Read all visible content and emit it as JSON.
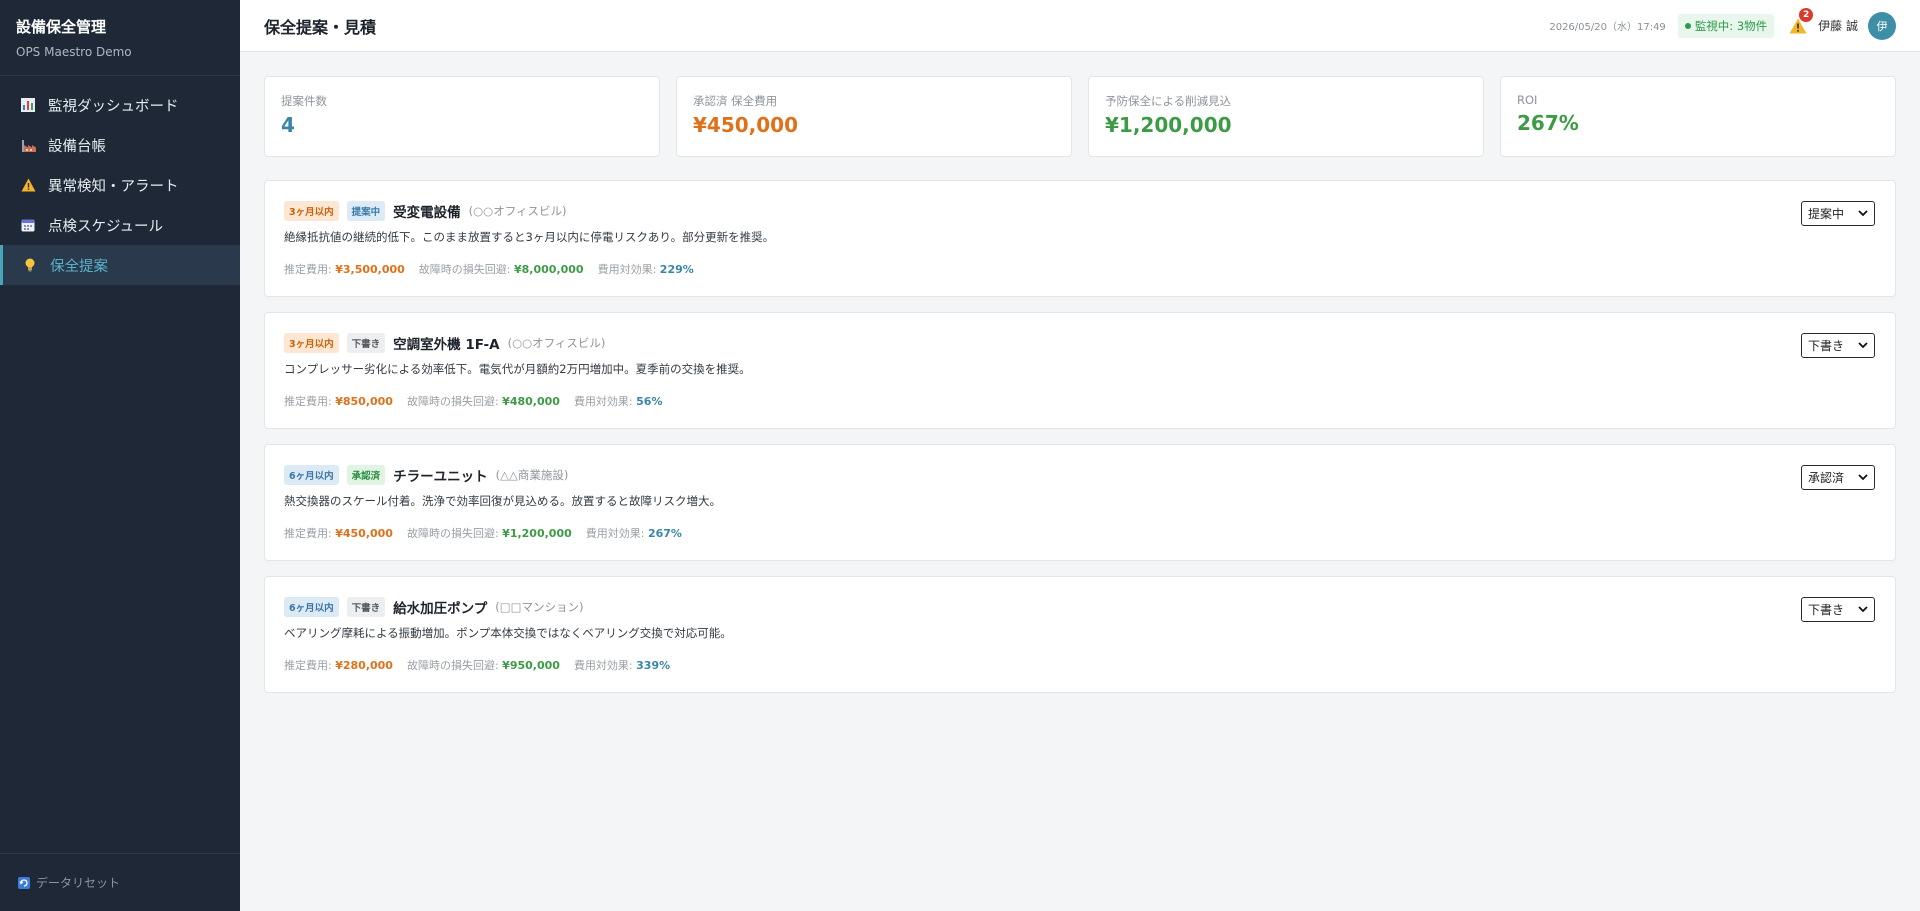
{
  "sidebar": {
    "title": "設備保全管理",
    "subtitle": "OPS Maestro Demo",
    "items": [
      {
        "label": "監視ダッシュボード",
        "icon": "bar-chart-icon"
      },
      {
        "label": "設備台帳",
        "icon": "factory-icon"
      },
      {
        "label": "異常検知・アラート",
        "icon": "warning-icon"
      },
      {
        "label": "点検スケジュール",
        "icon": "calendar-icon"
      },
      {
        "label": "保全提案",
        "icon": "lightbulb-icon"
      }
    ],
    "active_index": 4,
    "footer_label": "データリセット"
  },
  "header": {
    "title": "保全提案・見積",
    "datetime": "2026/05/20（水）17:49",
    "monitor_status": "監視中: 3物件",
    "alert_count": "2",
    "user_name": "伊藤 誠",
    "avatar_initial": "伊"
  },
  "stats": [
    {
      "label": "提案件数",
      "value": "4",
      "color": "#3a86a8"
    },
    {
      "label": "承認済 保全費用",
      "value": "¥450,000",
      "color": "#e0711a"
    },
    {
      "label": "予防保全による削減見込",
      "value": "¥1,200,000",
      "color": "#3d9b46"
    },
    {
      "label": "ROI",
      "value": "267%",
      "color": "#3d9b46"
    }
  ],
  "meta_labels": {
    "cost": "推定費用: ",
    "avoided": "故障時の損失回避: ",
    "effect": "費用対効果: "
  },
  "proposals": [
    {
      "period": "3ヶ月以内",
      "status": "提案中",
      "name": "受変電設備",
      "site": "(○○オフィスビル)",
      "desc": "絶縁抵抗値の継続的低下。このまま放置すると3ヶ月以内に停電リスクあり。部分更新を推奨。",
      "cost": "¥3,500,000",
      "avoided": "¥8,000,000",
      "effect": "229%",
      "select_value": "提案中"
    },
    {
      "period": "3ヶ月以内",
      "status": "下書き",
      "name": "空調室外機 1F-A",
      "site": "(○○オフィスビル)",
      "desc": "コンプレッサー劣化による効率低下。電気代が月額約2万円増加中。夏季前の交換を推奨。",
      "cost": "¥850,000",
      "avoided": "¥480,000",
      "effect": "56%",
      "select_value": "下書き"
    },
    {
      "period": "6ヶ月以内",
      "status": "承認済",
      "name": "チラーユニット",
      "site": "(△△商業施設)",
      "desc": "熱交換器のスケール付着。洗浄で効率回復が見込める。放置すると故障リスク増大。",
      "cost": "¥450,000",
      "avoided": "¥1,200,000",
      "effect": "267%",
      "select_value": "承認済"
    },
    {
      "period": "6ヶ月以内",
      "status": "下書き",
      "name": "給水加圧ポンプ",
      "site": "(□□マンション)",
      "desc": "ベアリング摩耗による振動増加。ポンプ本体交換ではなくベアリング交換で対応可能。",
      "cost": "¥280,000",
      "avoided": "¥950,000",
      "effect": "339%",
      "select_value": "下書き"
    }
  ],
  "colors": {
    "cost": "#e0711a",
    "avoided": "#3d9b46",
    "effect": "#3a86a8"
  }
}
